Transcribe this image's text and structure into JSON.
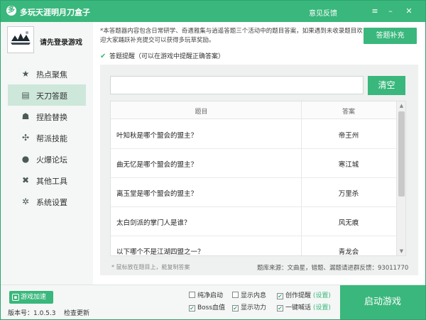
{
  "window": {
    "title": "多玩天涯明月刀盒子",
    "feedback": "意见反馈",
    "logo_glyph": "多"
  },
  "user": {
    "login_text": "请先登录游戏"
  },
  "sidebar": {
    "items": [
      {
        "label": "热点聚焦",
        "icon": "star-icon",
        "glyph": "★"
      },
      {
        "label": "天刀答题",
        "icon": "book-icon",
        "glyph": "▤"
      },
      {
        "label": "捏脸替换",
        "icon": "mask-icon",
        "glyph": "☗"
      },
      {
        "label": "帮派技能",
        "icon": "pinwheel-icon",
        "glyph": "✣"
      },
      {
        "label": "火爆论坛",
        "icon": "chat-bubble-icon",
        "glyph": "●"
      },
      {
        "label": "其他工具",
        "icon": "tools-icon",
        "glyph": "✖"
      },
      {
        "label": "系统设置",
        "icon": "gear-icon",
        "glyph": "✲"
      }
    ],
    "active_index": 1
  },
  "main": {
    "notice": "*本答题器内容包含日常研学、奇遇雅集与逍遥答题三个活动中的题目答案，如果遇到未收录题目欢迎大家踊跃补充提交可以获得多玩草奖励。",
    "supplement_button": "答题补充",
    "hint_checkbox": "答题提醒（可以在游戏中提醒正确答案）",
    "search": {
      "value": "",
      "placeholder": ""
    },
    "clear_button": "清空",
    "table": {
      "headers": [
        "题目",
        "答案"
      ],
      "rows": [
        [
          "叶知秋是哪个盟会的盟主？",
          "帝王州"
        ],
        [
          "曲无忆是哪个盟会的盟主？",
          "寒江城"
        ],
        [
          "离玉堂是哪个盟会的盟主？",
          "万里杀"
        ],
        [
          "太白剑派的掌门人是谁？",
          "风无痕"
        ],
        [
          "以下哪个不是江湖四盟之一？",
          "青龙会"
        ]
      ]
    },
    "tip_left": "* 鼠标放在题目上，能复制答案",
    "tip_right": "题库来源：文曲星，错题、漏题请进群反馈：93011770"
  },
  "footer": {
    "game_accel": "游戏加速",
    "version": "版本号：1.0.5.3",
    "check_update": "检查更新",
    "options": {
      "pure_start": {
        "label": "纯净启动",
        "checked": false
      },
      "show_memory": {
        "label": "显示内息",
        "checked": false
      },
      "create_remind": {
        "label": "创作提醒",
        "checked": true,
        "setting": "(设置)"
      },
      "boss_hp": {
        "label": "Boss血值",
        "checked": true
      },
      "show_power": {
        "label": "显示功力",
        "checked": true
      },
      "one_key_shout": {
        "label": "一键喊话",
        "checked": true,
        "setting": "(设置)"
      }
    },
    "launch_button": "启动游戏"
  },
  "colors": {
    "accent": "#3ab77c",
    "active_nav": "#cde7db"
  }
}
